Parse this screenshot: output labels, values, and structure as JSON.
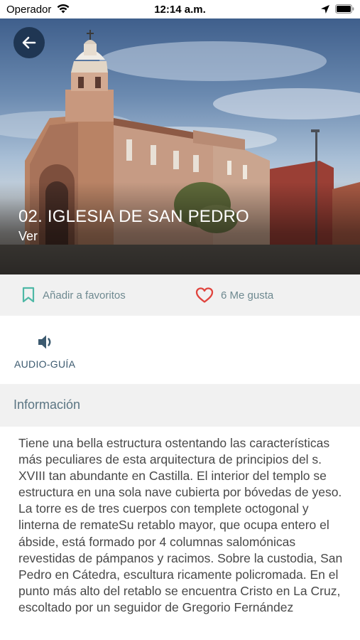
{
  "status_bar": {
    "carrier": "Operador",
    "time": "12:14 a.m."
  },
  "hero": {
    "title": "02. IGLESIA DE SAN PEDRO",
    "subtitle": "Ver"
  },
  "actions": {
    "favorite_label": "Añadir a favoritos",
    "likes_label": "6 Me gusta",
    "favorite_icon": "bookmark-icon",
    "like_icon": "heart-icon",
    "accent_color": "#4fb8a6",
    "like_color": "#e0443e"
  },
  "audio": {
    "label": "AUDIO-GUÍA",
    "icon": "speaker-icon"
  },
  "info": {
    "heading": "Información",
    "body": "Tiene una bella estructura ostentando las características más peculiares de esta arquitectura de principios del s. XVIII  tan abundante en Castilla. El interior del templo se estructura en una sola nave cubierta por bóvedas de yeso. La torre es de tres cuerpos  con templete octogonal y linterna de remateSu retablo mayor, que ocupa entero el ábside, está formado por 4 columnas salomónicas revestidas de pámpanos y racimos. Sobre la custodia, San Pedro en Cátedra, escultura ricamente policromada. En el punto más alto del retablo se encuentra Cristo en La Cruz, escoltado por un seguidor de Gregorio Fernández"
  }
}
